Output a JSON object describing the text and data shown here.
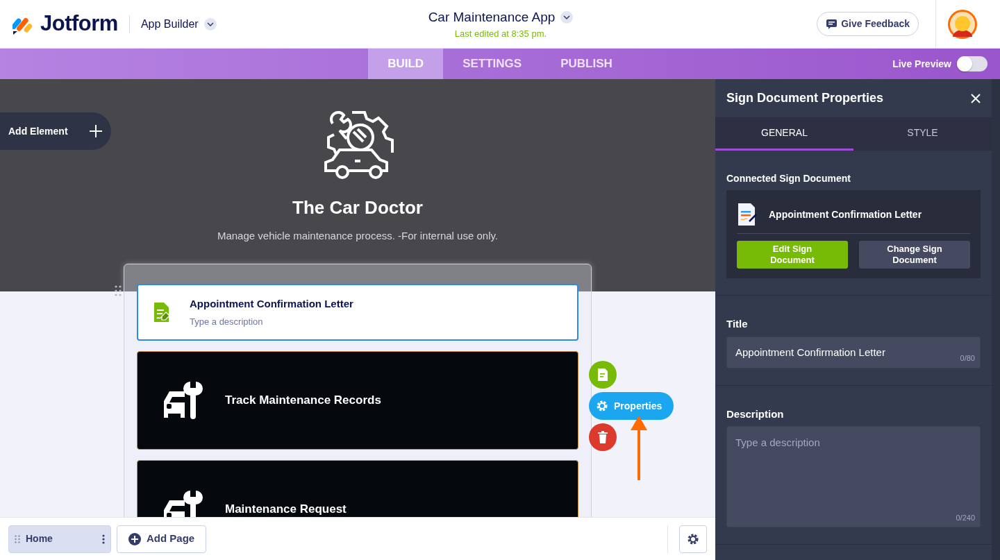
{
  "header": {
    "logo": "Jotform",
    "product": "App Builder",
    "app_title": "Car Maintenance App",
    "last_edited": "Last edited at 8:35 pm.",
    "feedback_button": "Give Feedback"
  },
  "nav_tabs": [
    {
      "label": "BUILD",
      "selected": true
    },
    {
      "label": "SETTINGS",
      "selected": false
    },
    {
      "label": "PUBLISH",
      "selected": false
    }
  ],
  "live_preview": {
    "label": "Live Preview",
    "on": false
  },
  "canvas": {
    "add_element": "Add Element",
    "app_name": "The Car Doctor",
    "app_description": "Manage vehicle maintenance process. -For internal use only.",
    "elements": [
      {
        "kind": "sign",
        "title": "Appointment Confirmation Letter",
        "description": "Type a description",
        "selected": true
      },
      {
        "kind": "button",
        "title": "Track Maintenance Records",
        "selected": false
      },
      {
        "kind": "button",
        "title": "Maintenance Request",
        "selected": false
      }
    ],
    "properties_button": "Properties"
  },
  "pages_bar": {
    "pages": [
      {
        "label": "Home",
        "selected": true
      }
    ],
    "add_page": "Add Page"
  },
  "panel": {
    "title": "Sign Document Properties",
    "tabs": [
      {
        "label": "GENERAL",
        "selected": true
      },
      {
        "label": "STYLE",
        "selected": false
      }
    ],
    "connected_label": "Connected Sign Document",
    "document_name": "Appointment Confirmation Letter",
    "edit_button": "Edit Sign Document",
    "change_button": "Change Sign Document",
    "fields": [
      {
        "kind": "input",
        "label": "Title",
        "value": "Appointment Confirmation Letter",
        "counter": "0/80"
      },
      {
        "kind": "textarea",
        "label": "Description",
        "placeholder": "Type a description",
        "counter": "0/240"
      }
    ]
  }
}
